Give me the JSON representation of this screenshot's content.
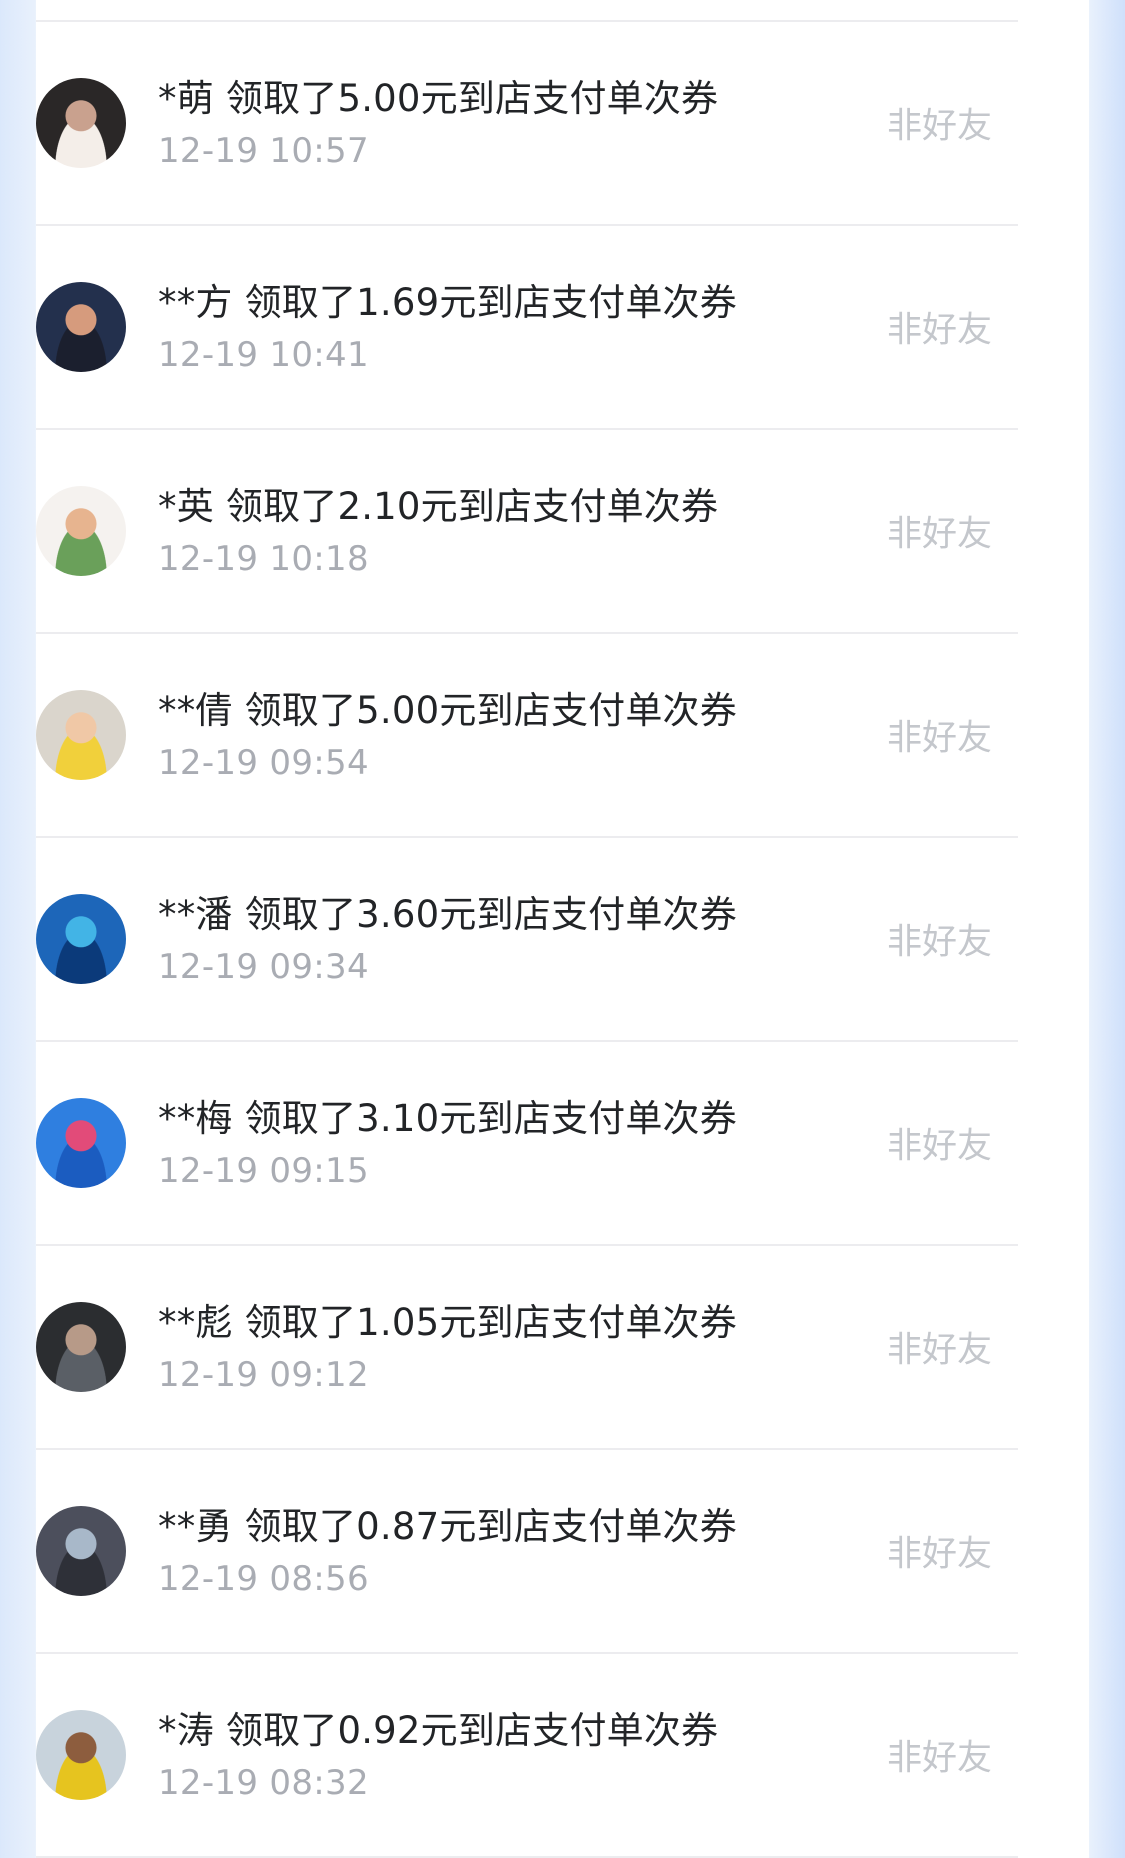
{
  "records": [
    {
      "name": "*萌",
      "action": "领取了5.00元到店支付单次券",
      "time": "12-19 10:57",
      "relation": "非好友",
      "avatar_colors": [
        "#2a2727",
        "#c9a18e",
        "#f4eee9"
      ]
    },
    {
      "name": "**方",
      "action": "领取了1.69元到店支付单次券",
      "time": "12-19 10:41",
      "relation": "非好友",
      "avatar_colors": [
        "#23304d",
        "#d69b7d",
        "#1b1f2e"
      ]
    },
    {
      "name": "*英",
      "action": "领取了2.10元到店支付单次券",
      "time": "12-19 10:18",
      "relation": "非好友",
      "avatar_colors": [
        "#f5f2ef",
        "#e7b48f",
        "#6aa05a"
      ]
    },
    {
      "name": "**倩",
      "action": "领取了5.00元到店支付单次券",
      "time": "12-19 09:54",
      "relation": "非好友",
      "avatar_colors": [
        "#dad5cc",
        "#f0c8a6",
        "#f1d03b"
      ]
    },
    {
      "name": "**潘",
      "action": "领取了3.60元到店支付单次券",
      "time": "12-19 09:34",
      "relation": "非好友",
      "avatar_colors": [
        "#1d66b9",
        "#42b4e6",
        "#0b3a7a"
      ]
    },
    {
      "name": "**梅",
      "action": "领取了3.10元到店支付单次券",
      "time": "12-19 09:15",
      "relation": "非好友",
      "avatar_colors": [
        "#2f7fe0",
        "#e24b79",
        "#1b5cc0"
      ]
    },
    {
      "name": "**彪",
      "action": "领取了1.05元到店支付单次券",
      "time": "12-19 09:12",
      "relation": "非好友",
      "avatar_colors": [
        "#2b2d30",
        "#b79a88",
        "#5a5f66"
      ]
    },
    {
      "name": "**勇",
      "action": "领取了0.87元到店支付单次券",
      "time": "12-19 08:56",
      "relation": "非好友",
      "avatar_colors": [
        "#4c4f5c",
        "#a8b8c9",
        "#2e3038"
      ]
    },
    {
      "name": "*涛",
      "action": "领取了0.92元到店支付单次券",
      "time": "12-19 08:32",
      "relation": "非好友",
      "avatar_colors": [
        "#c8d3dc",
        "#8d5d3e",
        "#e6c41f"
      ]
    }
  ]
}
